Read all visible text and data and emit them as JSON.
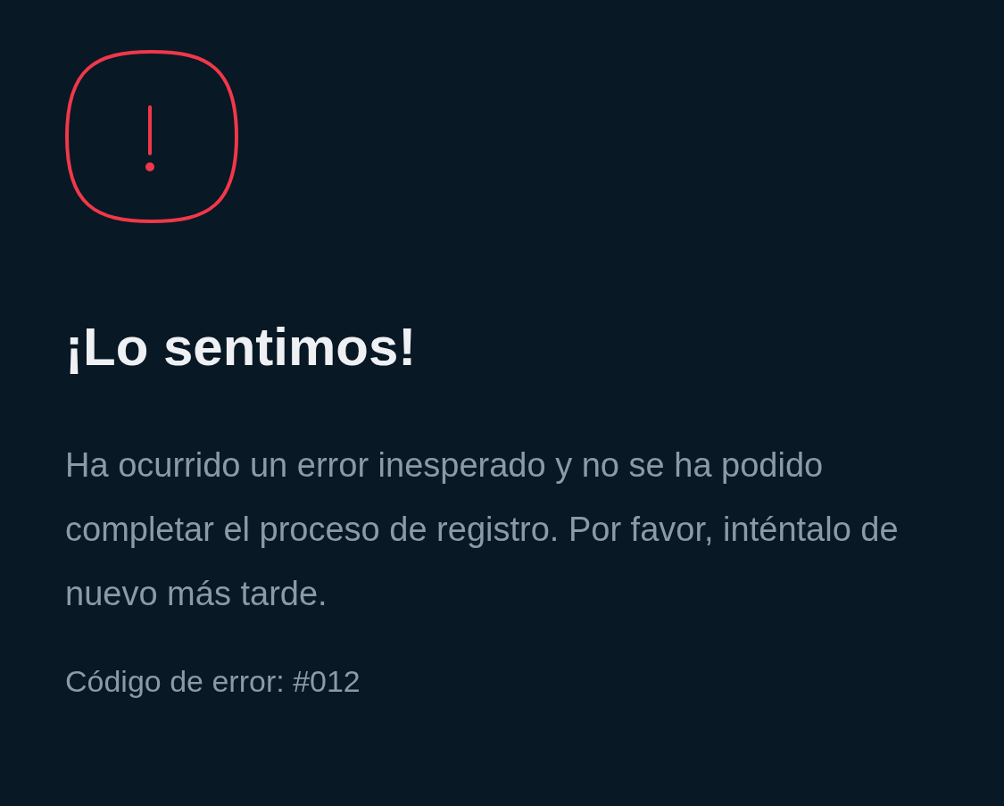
{
  "error": {
    "title": "¡Lo sentimos!",
    "message": "Ha ocurrido un error inesperado y no se ha podido completar el proceso de registro. Por favor, inténtalo de nuevo más tarde.",
    "code": "Código de error: #012"
  }
}
